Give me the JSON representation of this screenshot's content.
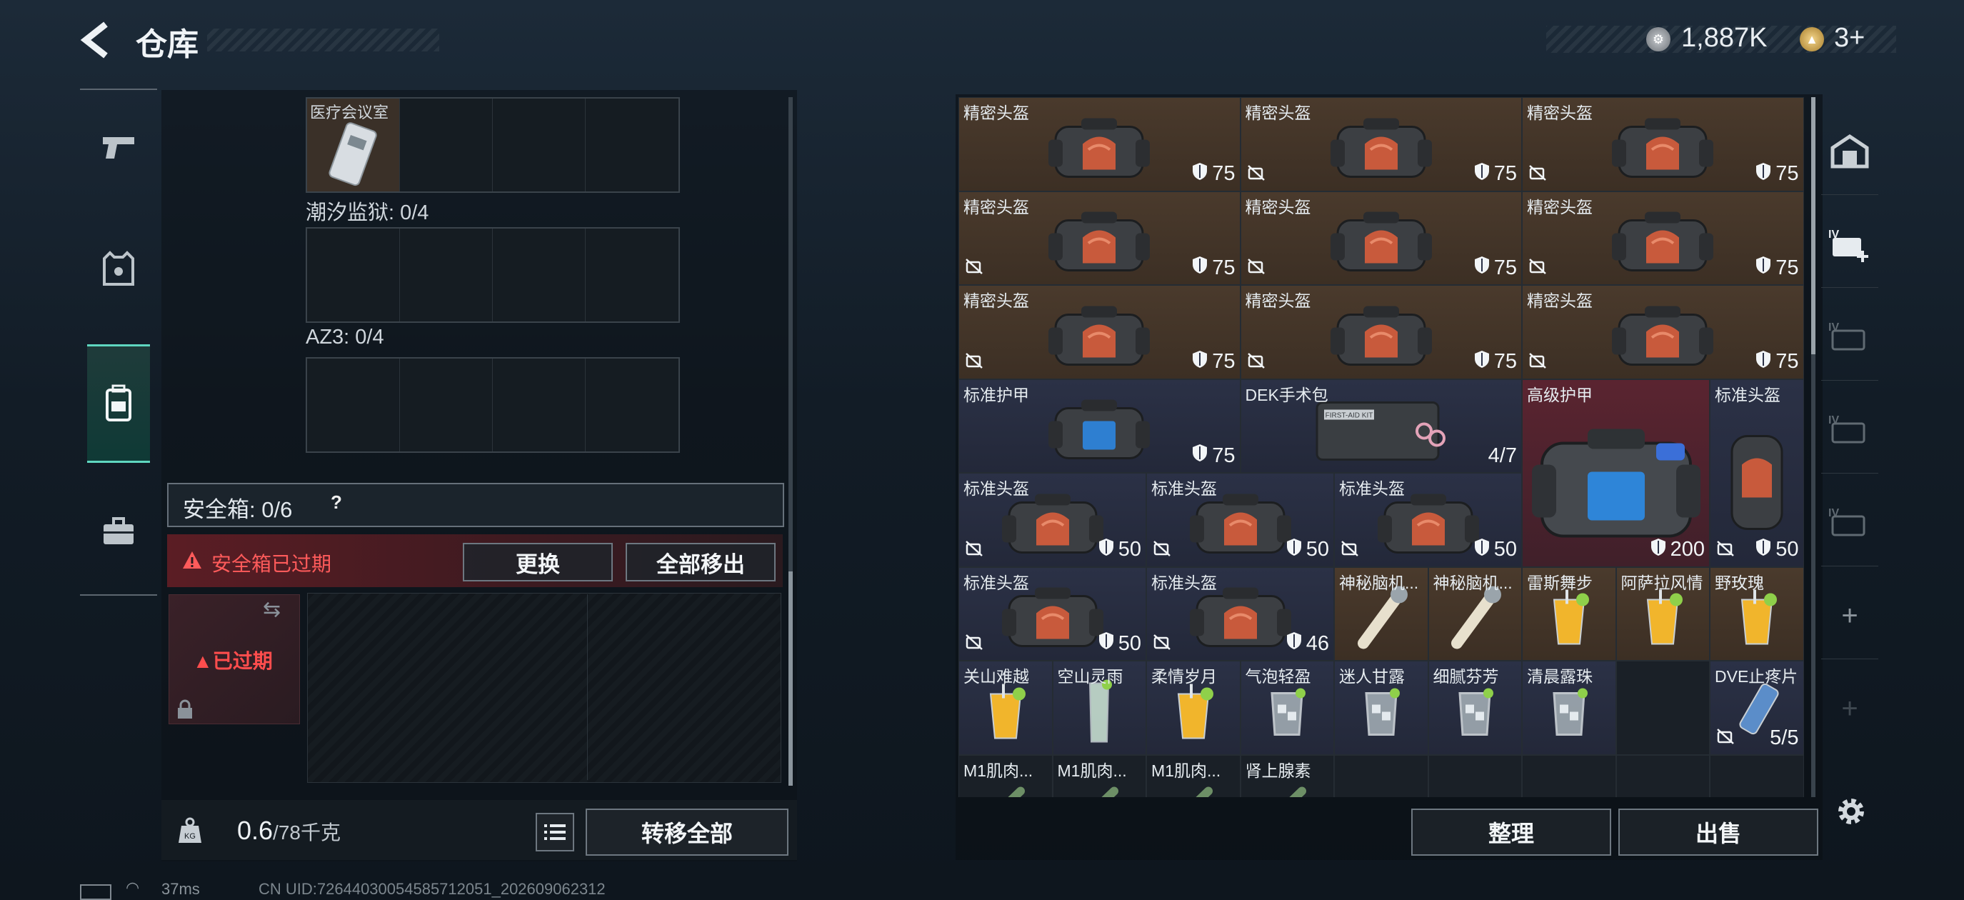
{
  "header": {
    "title": "仓库",
    "currency1": "1,887K",
    "currency2": "3+"
  },
  "left": {
    "first_container_label": "医疗会议室",
    "section1": "潮汐监狱: 0/4",
    "section2": "AZ3: 0/4",
    "safebox_label": "安全箱: 0/6",
    "safebox_help": "?",
    "expired_text": "安全箱已过期",
    "replace_button": "更换",
    "move_all_button": "全部移出",
    "expired_badge": "已过期",
    "weight_value": "0.6",
    "weight_max": "/78千克",
    "transfer_all_button": "转移全部"
  },
  "inventory": {
    "items": [
      {
        "name": "精密头盔",
        "value": "75",
        "nosell": false
      },
      {
        "name": "精密头盔",
        "value": "75",
        "nosell": true
      },
      {
        "name": "精密头盔",
        "value": "75",
        "nosell": true
      },
      {
        "name": "精密头盔",
        "value": "75",
        "nosell": true
      },
      {
        "name": "精密头盔",
        "value": "75",
        "nosell": true
      },
      {
        "name": "精密头盔",
        "value": "75",
        "nosell": true
      },
      {
        "name": "精密头盔",
        "value": "75",
        "nosell": true
      },
      {
        "name": "精密头盔",
        "value": "75",
        "nosell": true
      },
      {
        "name": "精密头盔",
        "value": "75",
        "nosell": true
      },
      {
        "name": "标准护甲",
        "value": "75",
        "nosell": false
      },
      {
        "name": "DEK手术包",
        "value": "4/7",
        "nosell": false
      },
      {
        "name": "高级护甲",
        "value": "200",
        "nosell": false
      },
      {
        "name": "标准头盔",
        "value": "50",
        "nosell": true
      },
      {
        "name": "标准头盔",
        "value": "50",
        "nosell": true
      },
      {
        "name": "标准头盔",
        "value": "50",
        "nosell": true
      },
      {
        "name": "标准头盔",
        "value": "50",
        "nosell": true
      },
      {
        "name": "标准头盔",
        "value": "50",
        "nosell": true
      },
      {
        "name": "标准头盔",
        "value": "46",
        "nosell": true
      },
      {
        "name": "神秘脑机...",
        "value": "",
        "nosell": false
      },
      {
        "name": "神秘脑机...",
        "value": "",
        "nosell": false
      },
      {
        "name": "雷斯舞步",
        "value": "",
        "nosell": false
      },
      {
        "name": "阿萨拉风情",
        "value": "",
        "nosell": false
      },
      {
        "name": "野玫瑰",
        "value": "",
        "nosell": false
      },
      {
        "name": "关山难越",
        "value": "",
        "nosell": false
      },
      {
        "name": "空山灵雨",
        "value": "",
        "nosell": false
      },
      {
        "name": "柔情岁月",
        "value": "",
        "nosell": false
      },
      {
        "name": "气泡轻盈",
        "value": "",
        "nosell": false
      },
      {
        "name": "迷人甘露",
        "value": "",
        "nosell": false
      },
      {
        "name": "细腻芬芳",
        "value": "",
        "nosell": false
      },
      {
        "name": "清晨露珠",
        "value": "",
        "nosell": false
      },
      {
        "name": "DVE止疼片",
        "value": "5/5",
        "nosell": true
      },
      {
        "name": "M1肌肉...",
        "value": "",
        "nosell": false
      },
      {
        "name": "M1肌肉...",
        "value": "",
        "nosell": false
      },
      {
        "name": "M1肌肉...",
        "value": "",
        "nosell": false
      },
      {
        "name": "肾上腺素",
        "value": "",
        "nosell": false
      }
    ],
    "organize_button": "整理",
    "sell_button": "出售"
  },
  "footer": {
    "ping": "37ms",
    "uid": "CN UID:72644030054585712051_202609062312"
  },
  "colors": {
    "accent": "#5fd7c0",
    "alert": "#ff5b5b",
    "rare_red": "#5a2430",
    "epic_brown": "#4a3a2c",
    "common_blue": "#2b3146"
  }
}
